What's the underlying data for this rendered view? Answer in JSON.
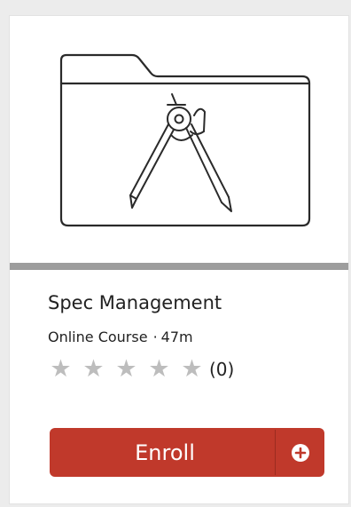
{
  "course": {
    "title": "Spec Management",
    "type": "Online Course",
    "separator": "·",
    "duration": "47m",
    "rating": {
      "stars_filled": 0,
      "stars_total": 5,
      "count": "(0)"
    },
    "thumbnail_icon": "folder-with-drafting-compass-icon"
  },
  "actions": {
    "enroll_label": "Enroll",
    "add_icon": "plus-circle-icon"
  },
  "colors": {
    "accent": "#c0392b",
    "star_empty": "#bdbdbd",
    "divider": "#9d9d9d"
  }
}
